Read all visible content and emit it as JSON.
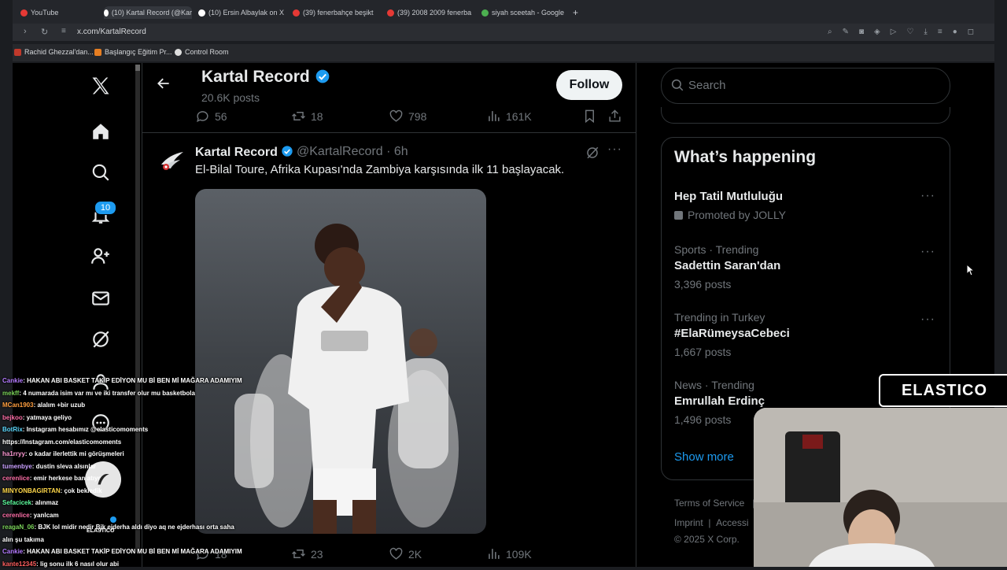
{
  "browser": {
    "tabs": [
      {
        "label": "YouTube",
        "color": "#e53935"
      },
      {
        "label": "(10) Kartal Record (@Kar",
        "color": "#ffffff"
      },
      {
        "label": "(10) Ersin Albaylak on X",
        "color": "#ffffff"
      },
      {
        "label": "(39) fenerbahçe beşikt",
        "color": "#e53935"
      },
      {
        "label": "(39) 2008 2009 fenerba",
        "color": "#e53935"
      },
      {
        "label": "siyah sceetah - Google",
        "color": "#4caf50"
      }
    ],
    "url": "x.com/KartalRecord",
    "bookmarks": [
      "Rachid Ghezzal'dan...",
      "Başlangıç Eğitim Pr...",
      "Control Room"
    ]
  },
  "nav": {
    "notification_count": "10"
  },
  "profile_header": {
    "name": "Kartal Record",
    "posts": "20.6K posts",
    "follow_label": "Follow"
  },
  "prev_tweet_stats": {
    "replies": "56",
    "reposts": "18",
    "likes": "798",
    "views": "161K"
  },
  "tweet": {
    "name": "Kartal Record",
    "handle": "@KartalRecord · 6h",
    "text": "El-Bilal Toure, Afrika Kupası'nda Zambiya karşısında ilk 11 başlayacak.",
    "stats": {
      "replies": "18",
      "reposts": "23",
      "likes": "2K",
      "views": "109K"
    }
  },
  "sidebar": {
    "search_placeholder": "Search",
    "happening_title": "What’s happening",
    "trends": [
      {
        "meta": "Promoted by JOLLY",
        "title": "Hep Tatil Mutluluğu",
        "promoted": true
      },
      {
        "meta": "Sports · Trending",
        "title": "Sadettin Saran'dan",
        "posts": "3,396 posts"
      },
      {
        "meta": "Trending in Turkey",
        "title": "#ElaRümeysaCebeci",
        "posts": "1,667 posts"
      },
      {
        "meta": "News · Trending",
        "title": "Emrullah Erdinç",
        "posts": "1,496 posts"
      }
    ],
    "show_more": "Show more",
    "footer": {
      "terms": "Terms of Service",
      "sep": "|",
      "imprint": "Imprint",
      "access": "Accessi",
      "copyright": "© 2025 X Corp."
    }
  },
  "chat": [
    {
      "user": "Cankie",
      "color": "#b57bff",
      "msg": ": HAKAN ABI BASKET TAKİP EDİYON MU Bİ BEN Mİ MAĞARA ADAMIYIM"
    },
    {
      "user": "mekff",
      "color": "#7bd35a",
      "msg": ": 4 numarada isim var mı ve iki transfer olur mu basketbola"
    },
    {
      "user": "MCan1903",
      "color": "#ff9f40",
      "msg": ": alalım +bir uzub"
    },
    {
      "user": "bejkoo",
      "color": "#ff6fa8",
      "msg": ": yatmaya geliyo"
    },
    {
      "user": "BotRix",
      "color": "#5dd9ff",
      "msg": ": Instagram hesabımız @elasticomoments"
    },
    {
      "user": "",
      "color": "#ffffff",
      "msg": "https://Instagram.com/elasticomoments"
    },
    {
      "user": "ha1rryy",
      "color": "#ff9ad5",
      "msg": ": o kadar ilerlettik mi görüşmeleri"
    },
    {
      "user": "tumenbye",
      "color": "#c9a0ff",
      "msg": ": dustin sleva alsınlar"
    },
    {
      "user": "cerenlice",
      "color": "#ff6fa8",
      "msg": ": emir herkese ban atıyo"
    },
    {
      "user": "MINYONBAGIRTAN",
      "color": "#ffd84a",
      "msg": ": çok bekledik"
    },
    {
      "user": "Sefacicek",
      "color": "#5dff9e",
      "msg": ": alınmaz"
    },
    {
      "user": "cerenlice",
      "color": "#ff6fa8",
      "msg": ": yanlcam"
    },
    {
      "user": "reagaN_06",
      "color": "#7bd35a",
      "msg": ": BJK lol midir nedir Bjk ejderha aldı diyo aq ne ejderhası orta saha"
    },
    {
      "user": "",
      "color": "#ffffff",
      "msg": "alın şu takıma"
    },
    {
      "user": "Cankie",
      "color": "#b57bff",
      "msg": ": HAKAN ABI BASKET TAKİP EDİYON MU Bİ BEN Mİ MAĞARA ADAMIYIM"
    },
    {
      "user": "kante12345",
      "color": "#ff6060",
      "msg": ": lig sonu ilk 6 nasıl olur abi"
    }
  ],
  "overlay": {
    "brand": "ELASTICO",
    "small_brand": "ELASTICO"
  }
}
